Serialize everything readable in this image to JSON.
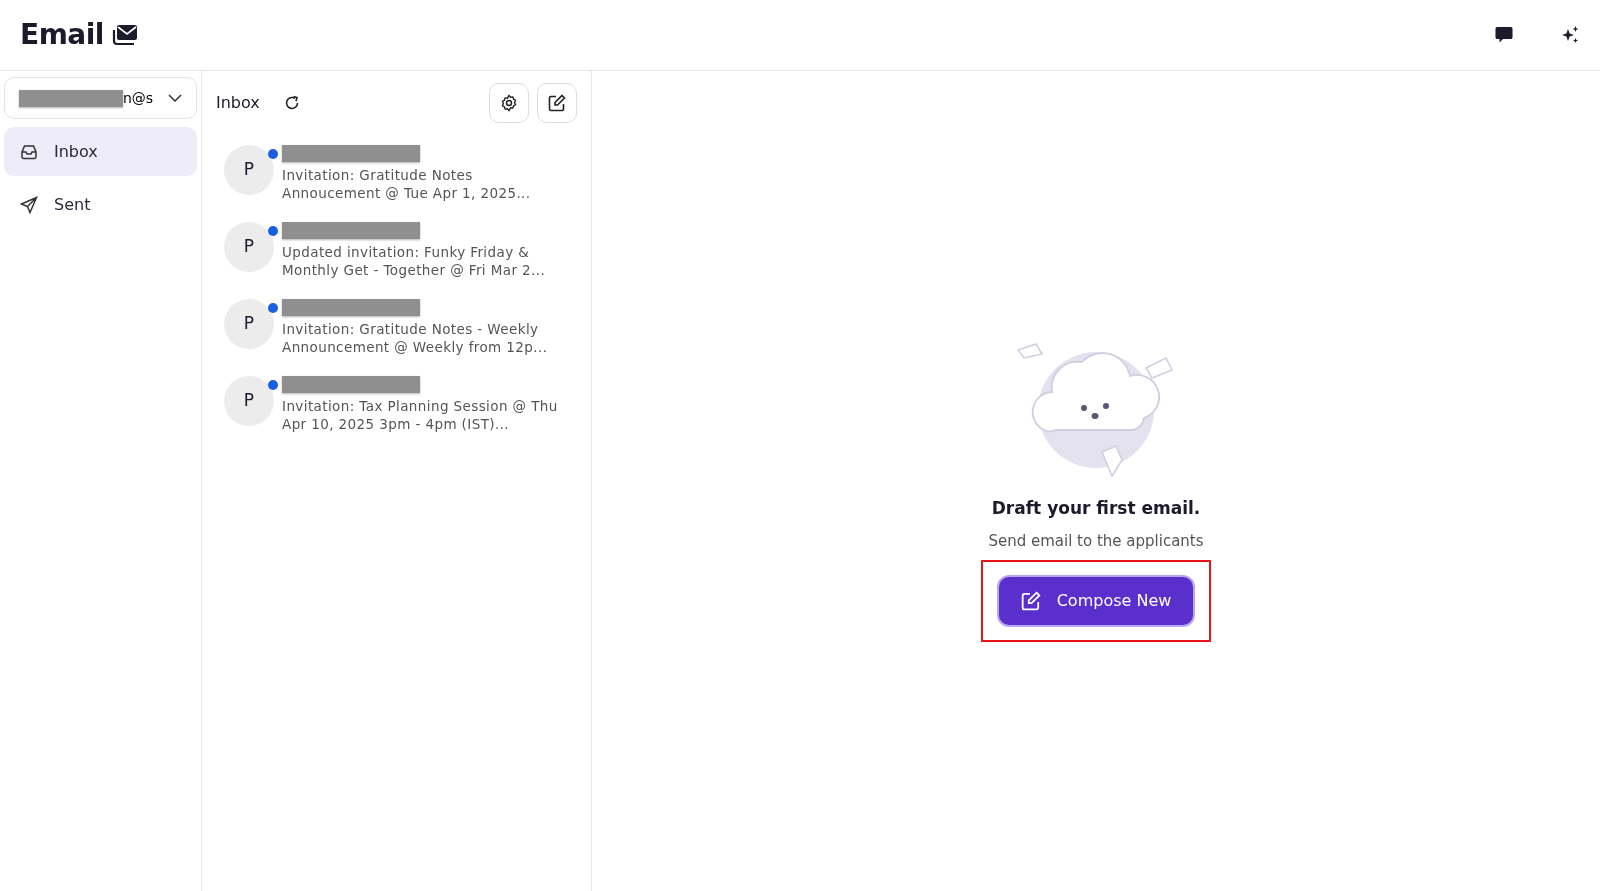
{
  "header": {
    "title": "Email"
  },
  "account": {
    "visible_text": "n@s",
    "redacted": true
  },
  "sidebar": {
    "items": [
      {
        "label": "Inbox",
        "kind": "inbox",
        "selected": true
      },
      {
        "label": "Sent",
        "kind": "sent",
        "selected": false
      }
    ]
  },
  "list": {
    "title": "Inbox",
    "messages": [
      {
        "avatar": "P",
        "unread": true,
        "sender_redacted": true,
        "subject": "Invitation: Gratitude Notes Annoucement @ Tue Apr 1, 2025..."
      },
      {
        "avatar": "P",
        "unread": true,
        "sender_redacted": true,
        "subject": "Updated invitation: Funky Friday & Monthly Get - Together @ Fri Mar 2..."
      },
      {
        "avatar": "P",
        "unread": true,
        "sender_redacted": true,
        "subject": "Invitation: Gratitude Notes - Weekly Announcement @ Weekly from 12p..."
      },
      {
        "avatar": "P",
        "unread": true,
        "sender_redacted": true,
        "subject": "Invitation: Tax Planning Session @ Thu Apr 10, 2025 3pm - 4pm (IST)..."
      }
    ]
  },
  "empty_state": {
    "title": "Draft your first email.",
    "subtitle": "Send email to the applicants",
    "button": "Compose New",
    "highlighted": true
  }
}
